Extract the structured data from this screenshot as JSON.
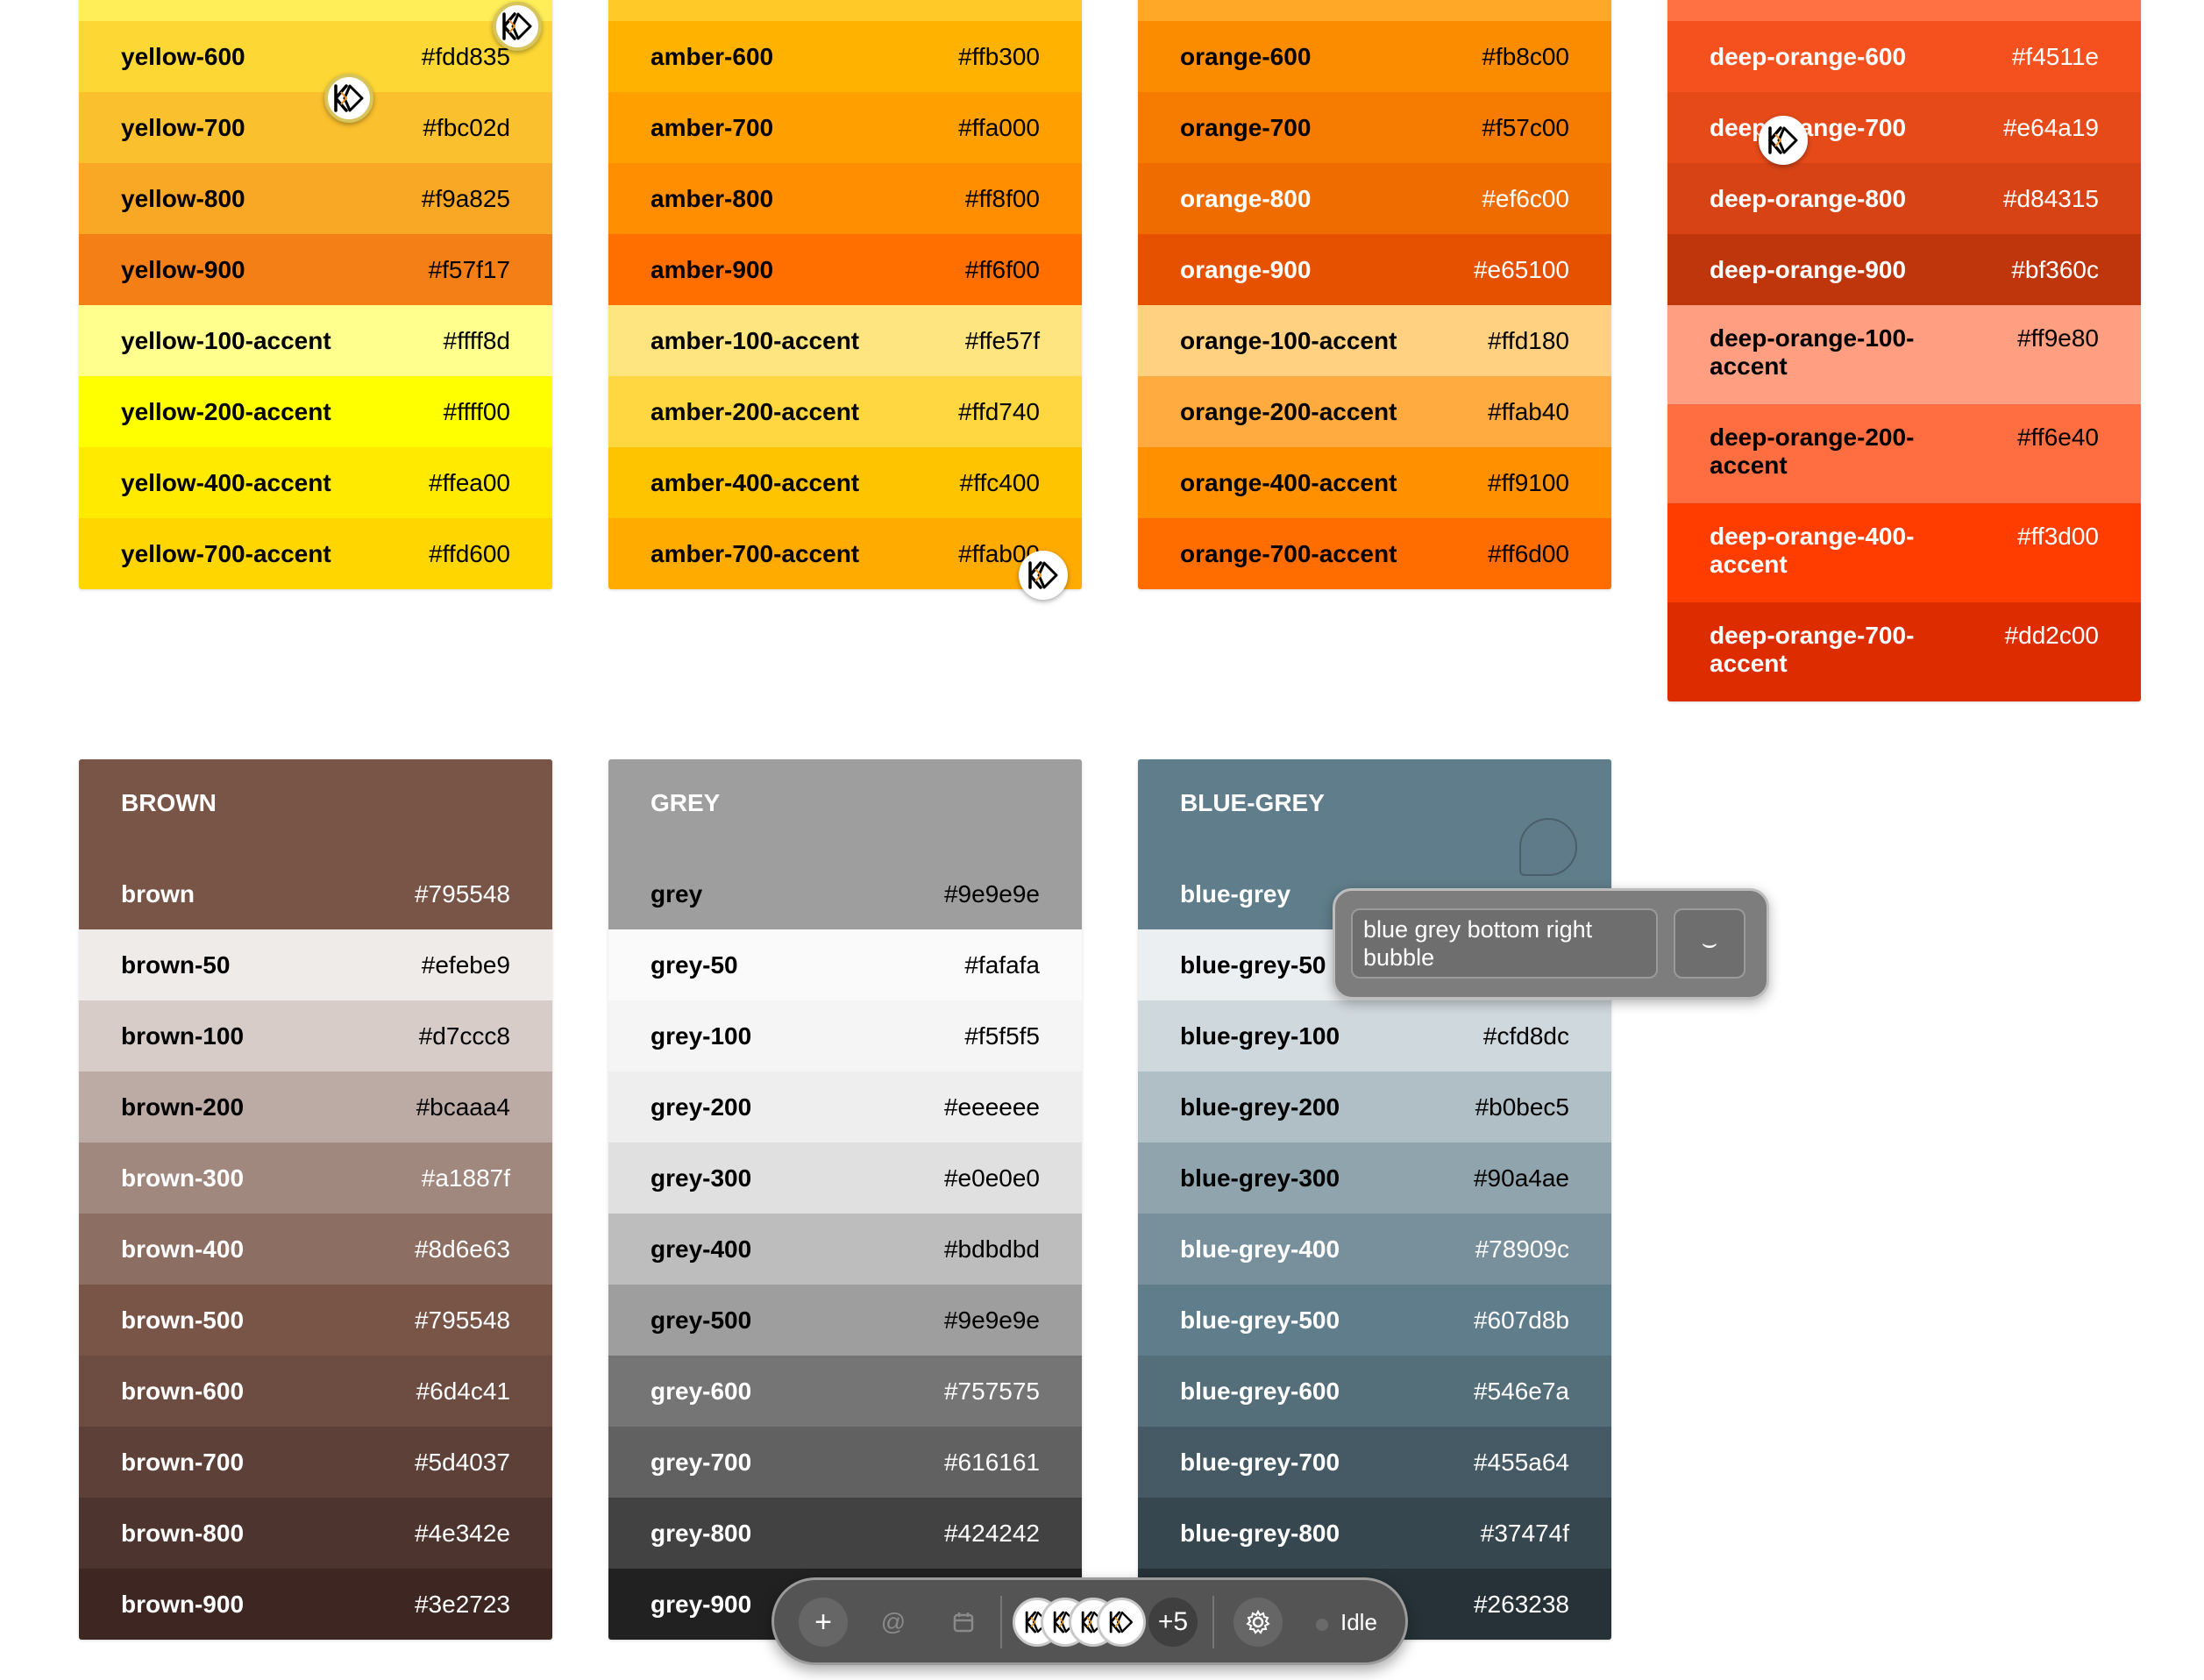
{
  "columns": [
    {
      "id": "yellow",
      "rows": [
        {
          "name": "",
          "hex": "",
          "bg": "#ffee58",
          "fg": "#000000"
        },
        {
          "name": "yellow-600",
          "hex": "#fdd835",
          "bg": "#fdd835",
          "fg": "#000000"
        },
        {
          "name": "yellow-700",
          "hex": "#fbc02d",
          "bg": "#fbc02d",
          "fg": "#000000"
        },
        {
          "name": "yellow-800",
          "hex": "#f9a825",
          "bg": "#f9a825",
          "fg": "#000000"
        },
        {
          "name": "yellow-900",
          "hex": "#f57f17",
          "bg": "#f57f17",
          "fg": "#000000"
        },
        {
          "name": "yellow-100-accent",
          "hex": "#ffff8d",
          "bg": "#ffff8d",
          "fg": "#000000"
        },
        {
          "name": "yellow-200-accent",
          "hex": "#ffff00",
          "bg": "#ffff00",
          "fg": "#000000"
        },
        {
          "name": "yellow-400-accent",
          "hex": "#ffea00",
          "bg": "#ffea00",
          "fg": "#000000"
        },
        {
          "name": "yellow-700-accent",
          "hex": "#ffd600",
          "bg": "#ffd600",
          "fg": "#000000"
        }
      ]
    },
    {
      "id": "amber",
      "rows": [
        {
          "name": "",
          "hex": "",
          "bg": "#ffca28",
          "fg": "#000000"
        },
        {
          "name": "amber-600",
          "hex": "#ffb300",
          "bg": "#ffb300",
          "fg": "#000000"
        },
        {
          "name": "amber-700",
          "hex": "#ffa000",
          "bg": "#ffa000",
          "fg": "#000000"
        },
        {
          "name": "amber-800",
          "hex": "#ff8f00",
          "bg": "#ff8f00",
          "fg": "#000000"
        },
        {
          "name": "amber-900",
          "hex": "#ff6f00",
          "bg": "#ff6f00",
          "fg": "#000000"
        },
        {
          "name": "amber-100-accent",
          "hex": "#ffe57f",
          "bg": "#ffe57f",
          "fg": "#000000"
        },
        {
          "name": "amber-200-accent",
          "hex": "#ffd740",
          "bg": "#ffd740",
          "fg": "#000000"
        },
        {
          "name": "amber-400-accent",
          "hex": "#ffc400",
          "bg": "#ffc400",
          "fg": "#000000"
        },
        {
          "name": "amber-700-accent",
          "hex": "#ffab00",
          "bg": "#ffab00",
          "fg": "#000000"
        }
      ]
    },
    {
      "id": "orange",
      "rows": [
        {
          "name": "",
          "hex": "",
          "bg": "#ffa726",
          "fg": "#000000"
        },
        {
          "name": "orange-600",
          "hex": "#fb8c00",
          "bg": "#fb8c00",
          "fg": "#000000"
        },
        {
          "name": "orange-700",
          "hex": "#f57c00",
          "bg": "#f57c00",
          "fg": "#000000"
        },
        {
          "name": "orange-800",
          "hex": "#ef6c00",
          "bg": "#ef6c00",
          "fg": "#ffffff"
        },
        {
          "name": "orange-900",
          "hex": "#e65100",
          "bg": "#e65100",
          "fg": "#ffffff"
        },
        {
          "name": "orange-100-accent",
          "hex": "#ffd180",
          "bg": "#ffd180",
          "fg": "#000000"
        },
        {
          "name": "orange-200-accent",
          "hex": "#ffab40",
          "bg": "#ffab40",
          "fg": "#000000"
        },
        {
          "name": "orange-400-accent",
          "hex": "#ff9100",
          "bg": "#ff9100",
          "fg": "#000000"
        },
        {
          "name": "orange-700-accent",
          "hex": "#ff6d00",
          "bg": "#ff6d00",
          "fg": "#000000"
        }
      ]
    },
    {
      "id": "deep-orange",
      "rows": [
        {
          "name": "",
          "hex": "",
          "bg": "#ff7043",
          "fg": "#ffffff"
        },
        {
          "name": "deep-orange-600",
          "hex": "#f4511e",
          "bg": "#f4511e",
          "fg": "#ffffff"
        },
        {
          "name": "deep-orange-700",
          "hex": "#e64a19",
          "bg": "#e64a19",
          "fg": "#ffffff"
        },
        {
          "name": "deep-orange-800",
          "hex": "#d84315",
          "bg": "#d84315",
          "fg": "#ffffff"
        },
        {
          "name": "deep-orange-900",
          "hex": "#bf360c",
          "bg": "#bf360c",
          "fg": "#ffffff"
        },
        {
          "name": "deep-orange-100-accent",
          "hex": "#ff9e80",
          "bg": "#ff9e80",
          "fg": "#000000",
          "tall": true
        },
        {
          "name": "deep-orange-200-accent",
          "hex": "#ff6e40",
          "bg": "#ff6e40",
          "fg": "#000000",
          "tall": true
        },
        {
          "name": "deep-orange-400-accent",
          "hex": "#ff3d00",
          "bg": "#ff3d00",
          "fg": "#ffffff",
          "tall": true
        },
        {
          "name": "deep-orange-700-accent",
          "hex": "#dd2c00",
          "bg": "#dd2c00",
          "fg": "#ffffff",
          "tall": true
        }
      ]
    },
    {
      "id": "brown",
      "header": {
        "label": "BROWN",
        "bg": "#795548"
      },
      "rows": [
        {
          "name": "brown",
          "hex": "#795548",
          "bg": "#795548",
          "fg": "#ffffff"
        },
        {
          "name": "brown-50",
          "hex": "#efebe9",
          "bg": "#efebe9",
          "fg": "#000000"
        },
        {
          "name": "brown-100",
          "hex": "#d7ccc8",
          "bg": "#d7ccc8",
          "fg": "#000000"
        },
        {
          "name": "brown-200",
          "hex": "#bcaaa4",
          "bg": "#bcaaa4",
          "fg": "#000000"
        },
        {
          "name": "brown-300",
          "hex": "#a1887f",
          "bg": "#a1887f",
          "fg": "#ffffff"
        },
        {
          "name": "brown-400",
          "hex": "#8d6e63",
          "bg": "#8d6e63",
          "fg": "#ffffff"
        },
        {
          "name": "brown-500",
          "hex": "#795548",
          "bg": "#795548",
          "fg": "#ffffff"
        },
        {
          "name": "brown-600",
          "hex": "#6d4c41",
          "bg": "#6d4c41",
          "fg": "#ffffff"
        },
        {
          "name": "brown-700",
          "hex": "#5d4037",
          "bg": "#5d4037",
          "fg": "#ffffff"
        },
        {
          "name": "brown-800",
          "hex": "#4e342e",
          "bg": "#4e342e",
          "fg": "#ffffff"
        },
        {
          "name": "brown-900",
          "hex": "#3e2723",
          "bg": "#3e2723",
          "fg": "#ffffff"
        }
      ]
    },
    {
      "id": "grey",
      "header": {
        "label": "GREY",
        "bg": "#9e9e9e"
      },
      "rows": [
        {
          "name": "grey",
          "hex": "#9e9e9e",
          "bg": "#9e9e9e",
          "fg": "#000000"
        },
        {
          "name": "grey-50",
          "hex": "#fafafa",
          "bg": "#fafafa",
          "fg": "#000000"
        },
        {
          "name": "grey-100",
          "hex": "#f5f5f5",
          "bg": "#f5f5f5",
          "fg": "#000000"
        },
        {
          "name": "grey-200",
          "hex": "#eeeeee",
          "bg": "#eeeeee",
          "fg": "#000000"
        },
        {
          "name": "grey-300",
          "hex": "#e0e0e0",
          "bg": "#e0e0e0",
          "fg": "#000000"
        },
        {
          "name": "grey-400",
          "hex": "#bdbdbd",
          "bg": "#bdbdbd",
          "fg": "#000000"
        },
        {
          "name": "grey-500",
          "hex": "#9e9e9e",
          "bg": "#9e9e9e",
          "fg": "#000000"
        },
        {
          "name": "grey-600",
          "hex": "#757575",
          "bg": "#757575",
          "fg": "#ffffff"
        },
        {
          "name": "grey-700",
          "hex": "#616161",
          "bg": "#616161",
          "fg": "#ffffff"
        },
        {
          "name": "grey-800",
          "hex": "#424242",
          "bg": "#424242",
          "fg": "#ffffff"
        },
        {
          "name": "grey-900",
          "hex": "",
          "bg": "#212121",
          "fg": "#ffffff"
        }
      ]
    },
    {
      "id": "blue-grey",
      "header": {
        "label": "BLUE-GREY",
        "bg": "#607d8b"
      },
      "rows": [
        {
          "name": "blue-grey",
          "hex": "",
          "bg": "#607d8b",
          "fg": "#ffffff"
        },
        {
          "name": "blue-grey-50",
          "hex": "",
          "bg": "#eceff1",
          "fg": "#000000"
        },
        {
          "name": "blue-grey-100",
          "hex": "#cfd8dc",
          "bg": "#cfd8dc",
          "fg": "#000000"
        },
        {
          "name": "blue-grey-200",
          "hex": "#b0bec5",
          "bg": "#b0bec5",
          "fg": "#000000"
        },
        {
          "name": "blue-grey-300",
          "hex": "#90a4ae",
          "bg": "#90a4ae",
          "fg": "#000000"
        },
        {
          "name": "blue-grey-400",
          "hex": "#78909c",
          "bg": "#78909c",
          "fg": "#ffffff"
        },
        {
          "name": "blue-grey-500",
          "hex": "#607d8b",
          "bg": "#607d8b",
          "fg": "#ffffff"
        },
        {
          "name": "blue-grey-600",
          "hex": "#546e7a",
          "bg": "#546e7a",
          "fg": "#ffffff"
        },
        {
          "name": "blue-grey-700",
          "hex": "#455a64",
          "bg": "#455a64",
          "fg": "#ffffff"
        },
        {
          "name": "blue-grey-800",
          "hex": "#37474f",
          "bg": "#37474f",
          "fg": "#ffffff"
        },
        {
          "name": "",
          "hex": "#263238",
          "bg": "#263238",
          "fg": "#ffffff"
        }
      ]
    }
  ],
  "comment": {
    "bubble_text": "blue grey bottom right bubble",
    "action_icon": "smile-icon"
  },
  "toolbar": {
    "add_icon": "plus-icon",
    "mention_icon": "at-icon",
    "calendar_icon": "calendar-icon",
    "avatar_count_extra": "+5",
    "settings_icon": "gear-icon",
    "status": "Idle"
  },
  "cursors": {
    "logo_text": "KD"
  }
}
